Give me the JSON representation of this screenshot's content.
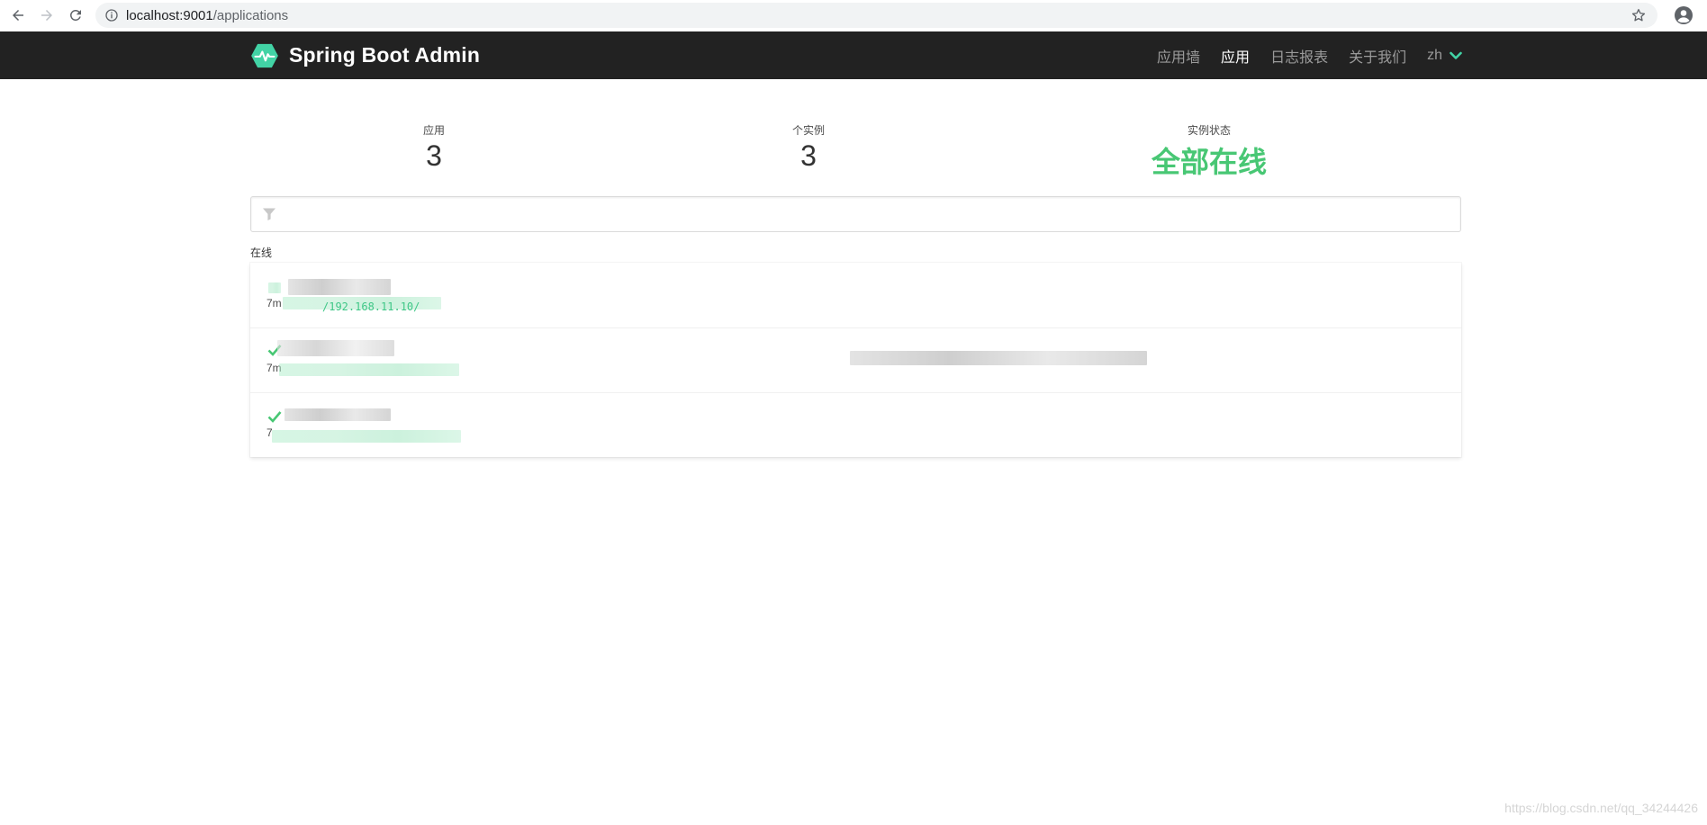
{
  "browser": {
    "url_host": "localhost:9001",
    "url_path": "/applications"
  },
  "navbar": {
    "brand": "Spring Boot Admin",
    "menu": [
      {
        "label": "应用墙",
        "active": false
      },
      {
        "label": "应用",
        "active": true
      },
      {
        "label": "日志报表",
        "active": false
      },
      {
        "label": "关于我们",
        "active": false
      }
    ],
    "language": "zh",
    "accent_color": "#42d3a5"
  },
  "stats": {
    "applications_label": "应用",
    "applications_value": "3",
    "instances_label": "个实例",
    "instances_value": "3",
    "status_label": "实例状态",
    "status_value": "全部在线",
    "status_color": "#48c774"
  },
  "filter": {
    "placeholder": "",
    "value": ""
  },
  "group": {
    "label": "在线"
  },
  "applications": [
    {
      "status": "up",
      "since": "7m",
      "url": "/192.168.11.10/"
    },
    {
      "status": "up",
      "since": "7m",
      "url": ""
    },
    {
      "status": "up",
      "since": "7",
      "url": ""
    }
  ],
  "watermark": "https://blog.csdn.net/qq_34244426"
}
